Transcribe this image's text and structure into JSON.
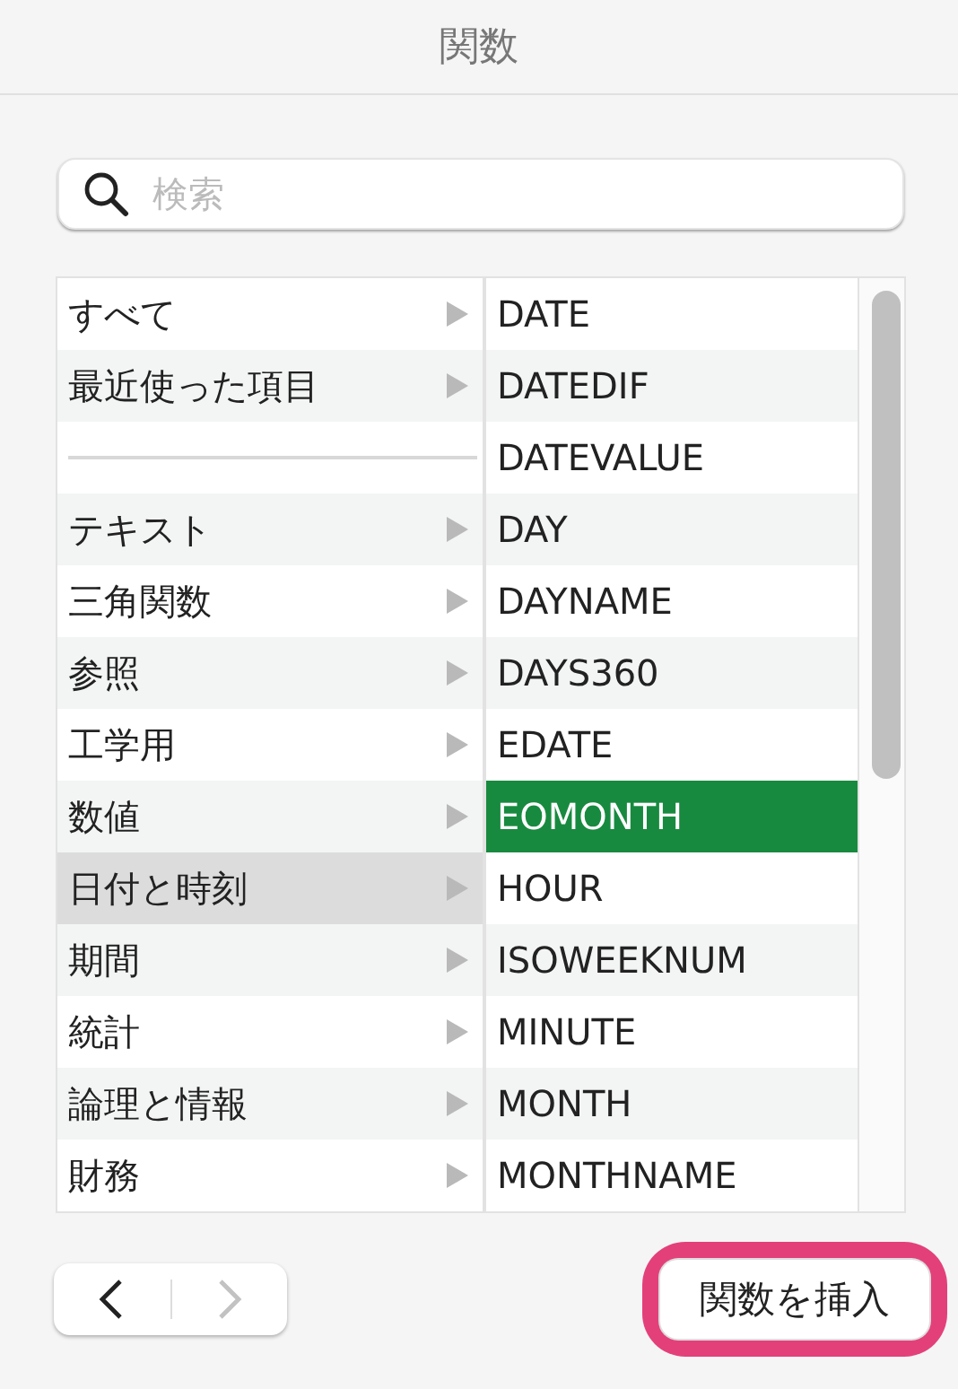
{
  "window": {
    "title": "関数"
  },
  "search": {
    "placeholder": "検索"
  },
  "categories": [
    {
      "kind": "item",
      "label": "すべて",
      "selected": false
    },
    {
      "kind": "item",
      "label": "最近使った項目",
      "selected": false
    },
    {
      "kind": "separator"
    },
    {
      "kind": "item",
      "label": "テキスト",
      "selected": false
    },
    {
      "kind": "item",
      "label": "三角関数",
      "selected": false
    },
    {
      "kind": "item",
      "label": "参照",
      "selected": false
    },
    {
      "kind": "item",
      "label": "工学用",
      "selected": false
    },
    {
      "kind": "item",
      "label": "数値",
      "selected": false
    },
    {
      "kind": "item",
      "label": "日付と時刻",
      "selected": true
    },
    {
      "kind": "item",
      "label": "期間",
      "selected": false
    },
    {
      "kind": "item",
      "label": "統計",
      "selected": false
    },
    {
      "kind": "item",
      "label": "論理と情報",
      "selected": false
    },
    {
      "kind": "item",
      "label": "財務",
      "selected": false
    }
  ],
  "functions": [
    {
      "label": "DATE",
      "selected": false
    },
    {
      "label": "DATEDIF",
      "selected": false
    },
    {
      "label": "DATEVALUE",
      "selected": false
    },
    {
      "label": "DAY",
      "selected": false
    },
    {
      "label": "DAYNAME",
      "selected": false
    },
    {
      "label": "DAYS360",
      "selected": false
    },
    {
      "label": "EDATE",
      "selected": false
    },
    {
      "label": "EOMONTH",
      "selected": true
    },
    {
      "label": "HOUR",
      "selected": false
    },
    {
      "label": "ISOWEEKNUM",
      "selected": false
    },
    {
      "label": "MINUTE",
      "selected": false
    },
    {
      "label": "MONTH",
      "selected": false
    },
    {
      "label": "MONTHNAME",
      "selected": false
    }
  ],
  "navigation": {
    "back_disabled": false,
    "forward_disabled": true
  },
  "insert_button": {
    "label": "関数を挿入",
    "highlighted": true
  }
}
